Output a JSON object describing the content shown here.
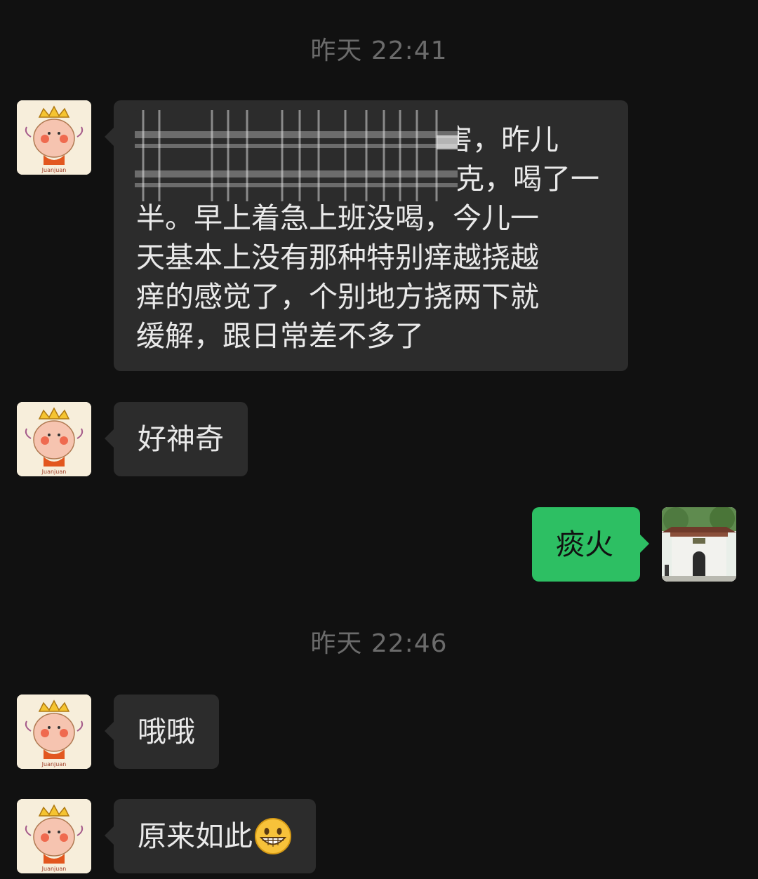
{
  "chat": {
    "timestamps": [
      "昨天 22:41",
      "昨天 22:46"
    ],
    "messages": {
      "m1": {
        "line1": "害，昨儿",
        "line2": "克，喝了一",
        "line3": "半。早上着急上班没喝，今儿一",
        "line4": "天基本上没有那种特别痒越挠越",
        "line5": "痒的感觉了，个别地方挠两下就",
        "line6": "缓解，跟日常差不多了"
      },
      "m2": "好神奇",
      "m3": "痰火",
      "m4": "哦哦",
      "m5": "原来如此"
    },
    "emoji": "grinning-face",
    "avatar_contact_label": "Juanjuan",
    "colors": {
      "background": "#111111",
      "incoming_bubble": "#2c2c2c",
      "outgoing_bubble": "#2dbf63",
      "timestamp": "#6b6b6b"
    }
  }
}
